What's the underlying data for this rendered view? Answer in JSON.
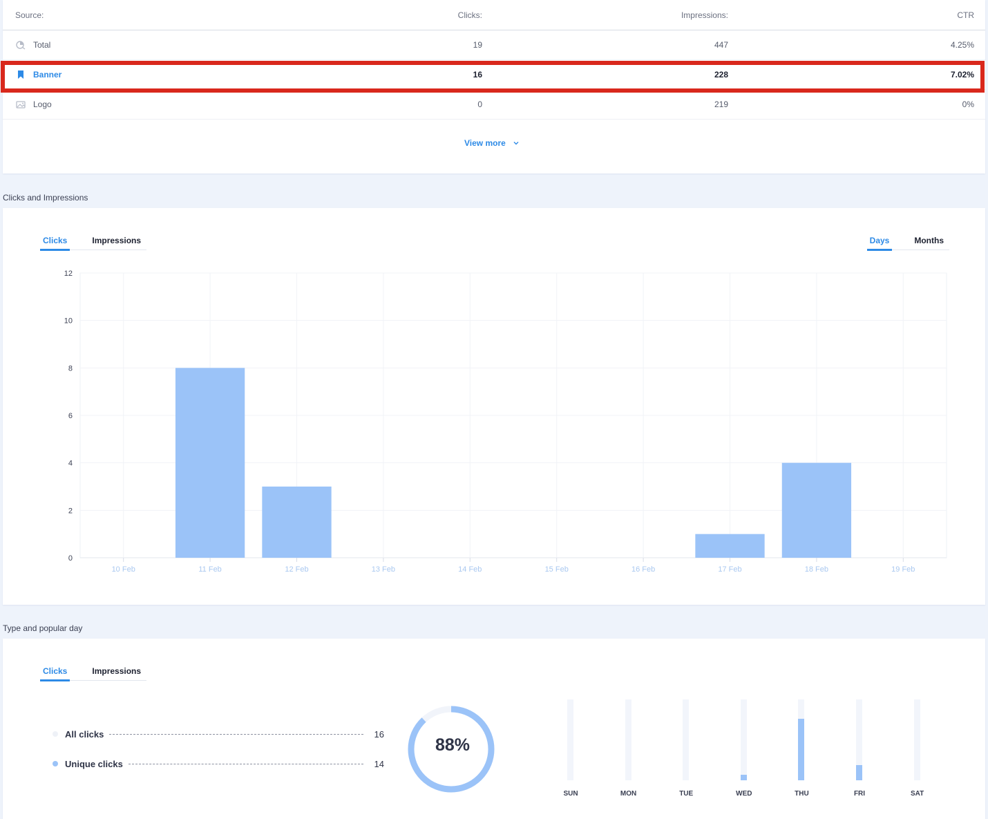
{
  "source_table": {
    "headers": {
      "source": "Source:",
      "clicks": "Clicks:",
      "impressions": "Impressions:",
      "ctr": "CTR"
    },
    "rows": [
      {
        "name": "Total",
        "icon": "chart-pie-icon",
        "clicks": "19",
        "impressions": "447",
        "ctr": "4.25%"
      },
      {
        "name": "Banner",
        "icon": "bookmark-icon",
        "clicks": "16",
        "impressions": "228",
        "ctr": "7.02%"
      },
      {
        "name": "Logo",
        "icon": "image-icon",
        "clicks": "0",
        "impressions": "219",
        "ctr": "0%"
      }
    ],
    "view_more": "View more",
    "selected_row": "Banner"
  },
  "clicks_section": {
    "title": "Clicks and Impressions",
    "metric_tabs": [
      "Clicks",
      "Impressions"
    ],
    "period_tabs": [
      "Days",
      "Months"
    ],
    "active_metric": "Clicks",
    "active_period": "Days"
  },
  "chart_data": {
    "type": "bar",
    "categories": [
      "10 Feb",
      "11 Feb",
      "12 Feb",
      "13 Feb",
      "14 Feb",
      "15 Feb",
      "16 Feb",
      "17 Feb",
      "18 Feb",
      "19 Feb"
    ],
    "values": [
      0,
      8,
      3,
      0,
      0,
      0,
      0,
      1,
      4,
      0
    ],
    "yticks": [
      0,
      2,
      4,
      6,
      8,
      10,
      12
    ],
    "ylim": [
      0,
      12
    ],
    "grid": true,
    "bar_color": "#9bc3f8",
    "title": "",
    "xlabel": "",
    "ylabel": ""
  },
  "type_section": {
    "title": "Type and popular day",
    "tabs": [
      "Clicks",
      "Impressions"
    ],
    "active_tab": "Clicks",
    "legend": [
      {
        "label": "All clicks",
        "value": "16",
        "color": "#eef1f7"
      },
      {
        "label": "Unique clicks",
        "value": "14",
        "color": "#9bc3f8"
      }
    ],
    "ring_percent": 88,
    "ring_label": "88%",
    "days": [
      {
        "label": "SUN",
        "fraction": 0
      },
      {
        "label": "MON",
        "fraction": 0
      },
      {
        "label": "TUE",
        "fraction": 0
      },
      {
        "label": "WED",
        "fraction": 0.07
      },
      {
        "label": "THU",
        "fraction": 0.76
      },
      {
        "label": "FRI",
        "fraction": 0.19
      },
      {
        "label": "SAT",
        "fraction": 0
      }
    ]
  },
  "colors": {
    "accent": "#2d8ae6",
    "bar": "#9bc3f8",
    "highlight": "#d9281c"
  }
}
